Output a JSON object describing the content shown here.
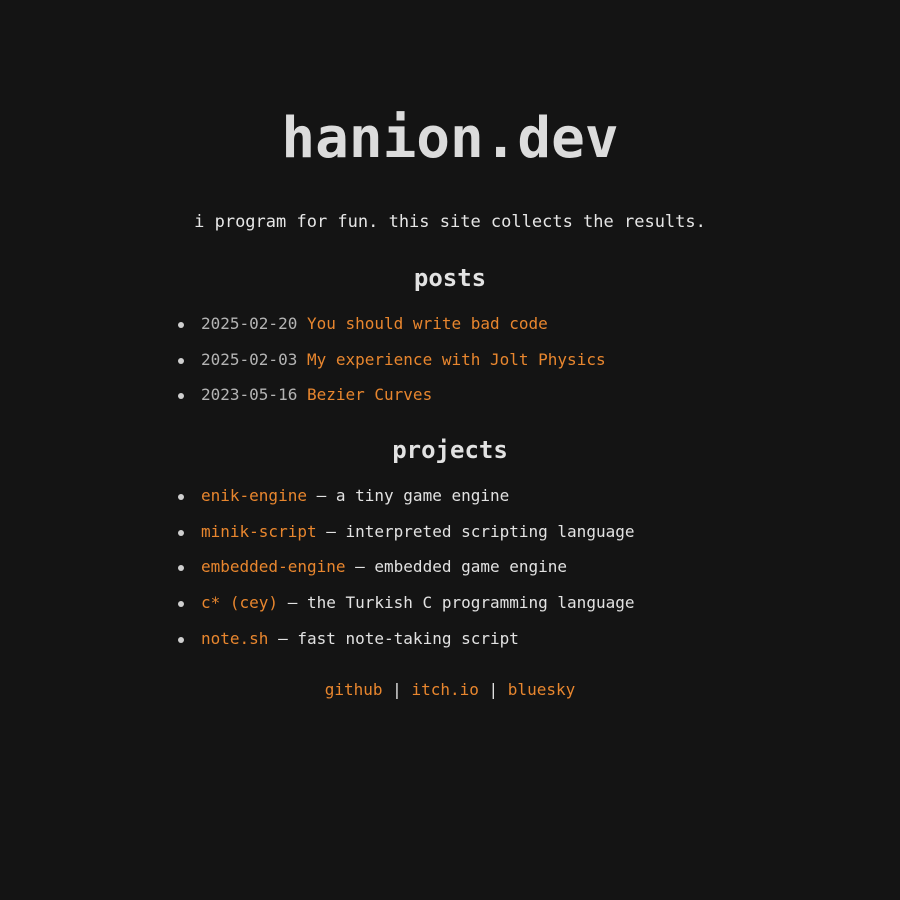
{
  "site": {
    "title": "hanion.dev",
    "tagline": "i program for fun. this site collects the results."
  },
  "posts": {
    "heading": "posts",
    "items": [
      {
        "date": "2025-02-20",
        "title": "You should write bad code"
      },
      {
        "date": "2025-02-03",
        "title": "My experience with Jolt Physics"
      },
      {
        "date": "2023-05-16",
        "title": "Bezier Curves"
      }
    ]
  },
  "projects": {
    "heading": "projects",
    "items": [
      {
        "name": "enik-engine",
        "desc": " – a tiny game engine"
      },
      {
        "name": "minik-script",
        "desc": " – interpreted scripting language"
      },
      {
        "name": "embedded-engine",
        "desc": " – embedded game engine"
      },
      {
        "name": "c* (cey)",
        "desc": " – the Turkish C programming language"
      },
      {
        "name": "note.sh",
        "desc": " – fast note-taking script"
      }
    ]
  },
  "footer": {
    "links": [
      "github",
      "itch.io",
      "bluesky"
    ],
    "separator": " | "
  },
  "colors": {
    "background": "#141414",
    "text": "#e2e2e2",
    "accent": "#e8862e",
    "date": "#b4b4b4"
  }
}
